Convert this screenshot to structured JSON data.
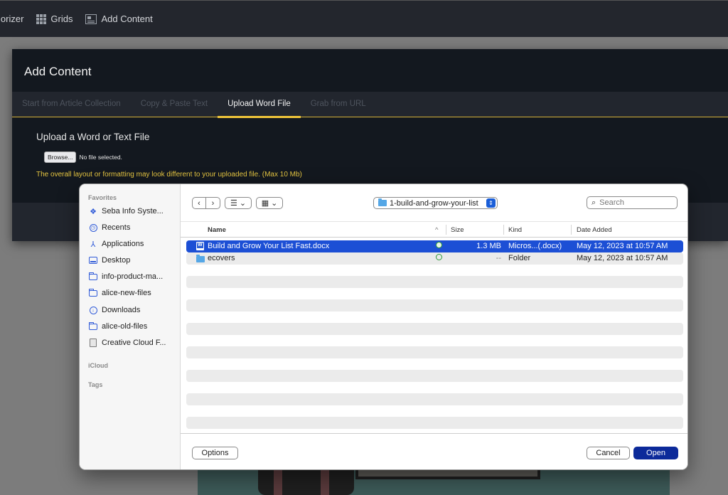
{
  "topbar": {
    "items": [
      {
        "label": "lorizer",
        "icon": "none"
      },
      {
        "label": "Grids",
        "icon": "grid-icon"
      },
      {
        "label": "Add Content",
        "icon": "add-content-icon"
      }
    ]
  },
  "modal": {
    "title": "Add Content",
    "tabs": [
      {
        "label": "Start from Article Collection",
        "active": false
      },
      {
        "label": "Copy & Paste Text",
        "active": false
      },
      {
        "label": "Upload Word File",
        "active": true
      },
      {
        "label": "Grab from URL",
        "active": false
      }
    ],
    "upload_heading": "Upload a Word or Text File",
    "browse_label": "Browse...",
    "no_file_text": "No file selected.",
    "notice": "The overall layout or formatting may look different to your uploaded file. (Max 10 Mb)",
    "accent_color": "#f0c53a"
  },
  "dialog": {
    "sidebar": {
      "favorites_label": "Favorites",
      "favorites": [
        {
          "label": "Seba Info Syste...",
          "icon": "dropbox-icon"
        },
        {
          "label": "Recents",
          "icon": "clock-icon"
        },
        {
          "label": "Applications",
          "icon": "applications-icon"
        },
        {
          "label": "Desktop",
          "icon": "desktop-icon"
        },
        {
          "label": "info-product-ma...",
          "icon": "folder-icon"
        },
        {
          "label": "alice-new-files",
          "icon": "folder-icon"
        },
        {
          "label": "Downloads",
          "icon": "download-icon"
        },
        {
          "label": "alice-old-files",
          "icon": "folder-icon"
        },
        {
          "label": "Creative Cloud F...",
          "icon": "document-icon"
        }
      ],
      "icloud_label": "iCloud",
      "tags_label": "Tags"
    },
    "toolbar": {
      "back": "‹",
      "forward": "›",
      "list_view_icon": "☰",
      "grid_view_icon": "▦",
      "chevron": "⌄",
      "current_folder": "1-build-and-grow-your-list",
      "search_placeholder": "Search"
    },
    "columns": {
      "name": "Name",
      "sort_indicator": "^",
      "size": "Size",
      "kind": "Kind",
      "date_added": "Date Added"
    },
    "files": [
      {
        "name": "Build and Grow Your List Fast.docx",
        "size": "1.3 MB",
        "kind": "Micros...(.docx)",
        "date_added": "May 12, 2023 at 10:57 AM",
        "selected": true,
        "type": "docx"
      },
      {
        "name": "ecovers",
        "size": "--",
        "kind": "Folder",
        "date_added": "May 12, 2023 at 10:57 AM",
        "selected": false,
        "type": "folder"
      }
    ],
    "buttons": {
      "options": "Options",
      "cancel": "Cancel",
      "open": "Open"
    },
    "selection_color": "#1c4fd5"
  }
}
